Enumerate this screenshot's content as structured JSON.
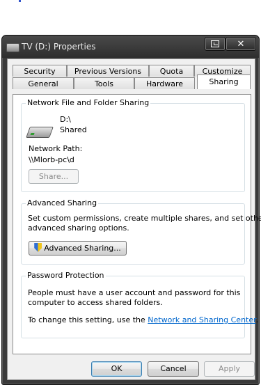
{
  "window": {
    "title": "TV (D:) Properties",
    "restore_icon": "restore-icon",
    "close_glyph": "✕"
  },
  "tabs": {
    "row1": [
      "Security",
      "Previous Versions",
      "Quota",
      "Customize"
    ],
    "row2": [
      "General",
      "Tools",
      "Hardware",
      "Sharing"
    ],
    "selected": "Sharing"
  },
  "network_sharing": {
    "label": "Network File and Folder Sharing",
    "drive_name": "D:\\",
    "drive_status": "Shared",
    "path_label": "Network Path:",
    "path_value": "\\\\Mlorb-pc\\d",
    "share_button": "Share..."
  },
  "advanced_sharing": {
    "label": "Advanced Sharing",
    "description_line1": "Set custom permissions, create multiple shares, and set other",
    "description_line2": "advanced sharing options.",
    "button": "Advanced Sharing..."
  },
  "password_protection": {
    "label": "Password Protection",
    "line1": "People must have a user account and password for this",
    "line2": "computer to access shared folders.",
    "line3_prefix": "To change this setting, use the ",
    "link": "Network and Sharing Center",
    "line3_suffix": "."
  },
  "footer": {
    "ok": "OK",
    "cancel": "Cancel",
    "apply": "Apply"
  }
}
